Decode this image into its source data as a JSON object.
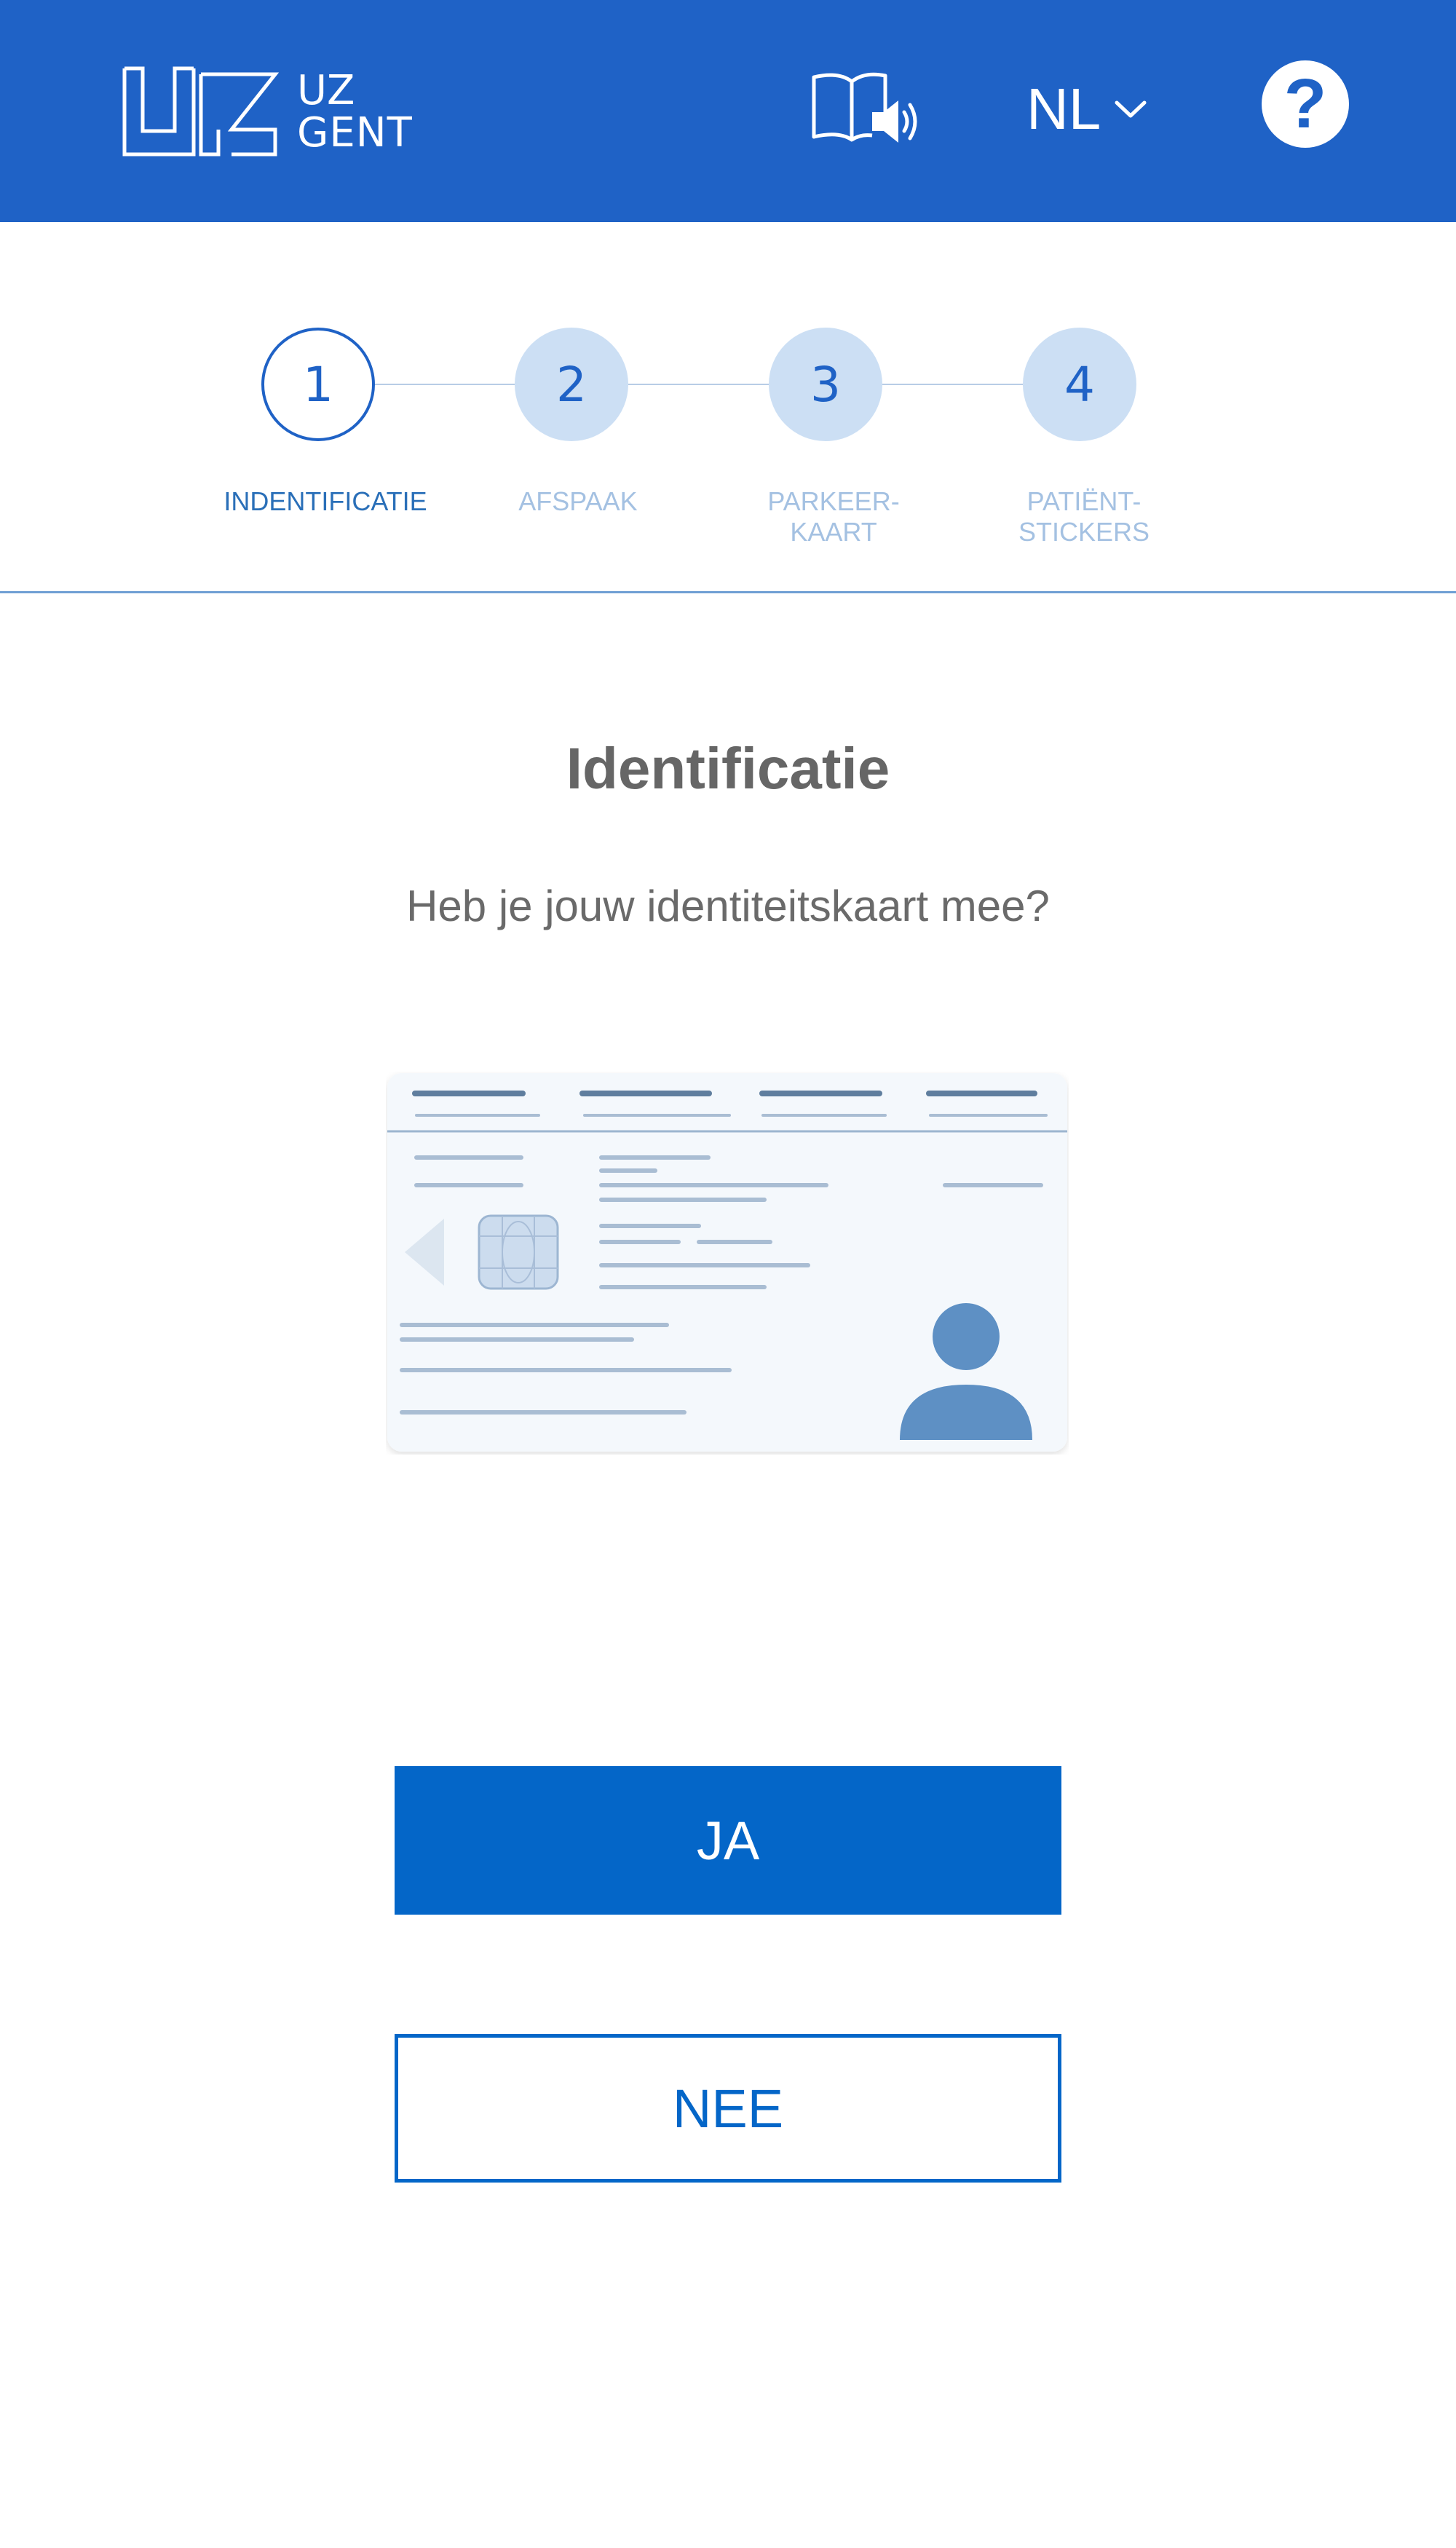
{
  "header": {
    "logo_lines": [
      "UZ",
      "GENT"
    ],
    "language": "NL",
    "help_symbol": "?",
    "icons": {
      "logo": "uz-gent-logo-icon",
      "read_aloud": "book-speaker-icon",
      "language_dropdown": "chevron-down-icon",
      "help": "question-mark-icon"
    },
    "color": "#1F62C6"
  },
  "stepper": {
    "steps": [
      {
        "number": "1",
        "label": "INDENTIFICATIE",
        "state": "active"
      },
      {
        "number": "2",
        "label": "AFSPAAK",
        "state": "upcoming"
      },
      {
        "number": "3",
        "label": "PARKEER-\nKAART",
        "state": "upcoming"
      },
      {
        "number": "4",
        "label": "PATIËNT-\nSTICKERS",
        "state": "upcoming"
      }
    ]
  },
  "main": {
    "title": "Identificatie",
    "question": "Heb je jouw identiteitskaart mee?",
    "illustration": "id-card-icon",
    "yes_label": "JA",
    "no_label": "NEE"
  },
  "colors": {
    "primary": "#0466C8",
    "header": "#1F62C6",
    "step_inactive": "#CCDFF4",
    "text_gray": "#666666"
  }
}
